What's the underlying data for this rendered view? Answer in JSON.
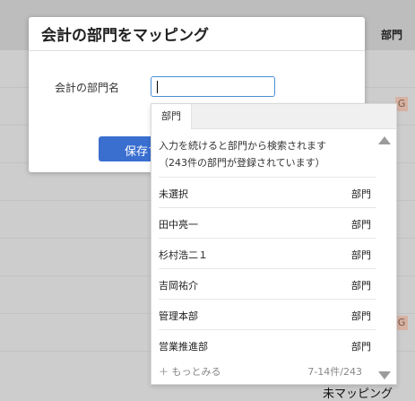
{
  "background": {
    "header_col": "部門",
    "chips": [
      "G",
      "G"
    ],
    "footer_text": "未マッピング"
  },
  "modal": {
    "title": "会計の部門をマッピング",
    "field_label": "会計の部門名",
    "input_value": "",
    "save_label": "保存する"
  },
  "dropdown": {
    "tab_label": "部門",
    "info_line1": "入力を続けると部門から検索されます",
    "info_line2": "（243件の部門が登録されています）",
    "items": [
      {
        "name": "未選択",
        "type": "部門"
      },
      {
        "name": "田中亮一",
        "type": "部門"
      },
      {
        "name": "杉村浩二１",
        "type": "部門"
      },
      {
        "name": "吉岡祐介",
        "type": "部門"
      },
      {
        "name": "管理本部",
        "type": "部門"
      },
      {
        "name": "営業推進部",
        "type": "部門"
      }
    ],
    "more_label": "＋ もっとみる",
    "count_label": "7-14件/243"
  },
  "colors": {
    "primary": "#3a6fd0",
    "input_border": "#4a8fd6",
    "overlay": "#cdcdcd"
  }
}
